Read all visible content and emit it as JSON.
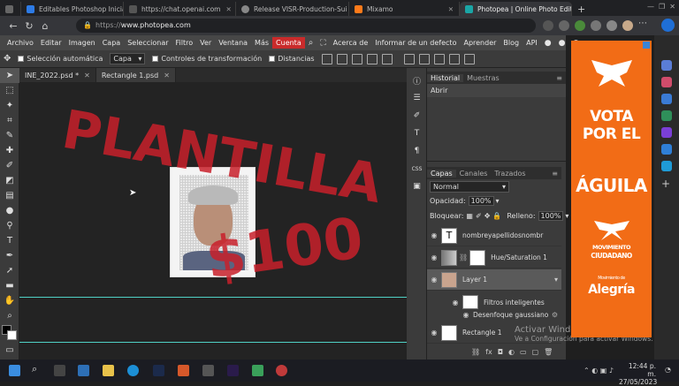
{
  "browser": {
    "tabs": [
      {
        "label": "Editables Photoshop Iniciativ",
        "color": "#2d7be6"
      },
      {
        "label": "https://chat.openai.com",
        "color": "#555555"
      },
      {
        "label": "Release VISR-Production-Sui",
        "color": "#555555"
      },
      {
        "label": "Mixamo",
        "color": "#ff7a1a"
      },
      {
        "label": "Photopea | Online Photo Edit",
        "color": "#1aa6a6"
      }
    ],
    "new_tab": "+",
    "url_scheme": "https://",
    "url_host": "www.photopea.com"
  },
  "menu": {
    "items": [
      "Archivo",
      "Editar",
      "Imagen",
      "Capa",
      "Seleccionar",
      "Filtro",
      "Ver",
      "Ventana",
      "Más"
    ],
    "account": "Cuenta",
    "right_items": [
      "Acerca de",
      "Informar de un defecto",
      "Aprender",
      "Blog",
      "API"
    ]
  },
  "options": {
    "auto_select": "Selección automática",
    "layer_select": "Capa",
    "transform_controls": "Controles de transformación",
    "distances": "Distancias"
  },
  "documents": {
    "tabs": [
      "INE_2022.psd *",
      "Rectangle 1.psd"
    ]
  },
  "canvas": {
    "watermark_line1": "PLANTILLA",
    "watermark_line2": "$100",
    "watermark_color": "#c8202a"
  },
  "history": {
    "tabs": [
      "Historial",
      "Muestras"
    ],
    "items": [
      "Abrir"
    ]
  },
  "layers_panel": {
    "tabs": [
      "Capas",
      "Canales",
      "Trazados"
    ],
    "blend_mode": "Normal",
    "opacity_label": "Opacidad:",
    "opacity_value": "100%",
    "lock_label": "Bloquear:",
    "fill_label": "Relleno:",
    "fill_value": "100%",
    "layers": [
      {
        "name": "nombreyapellidosnombr",
        "kind": "text"
      },
      {
        "name": "Hue/Saturation 1",
        "kind": "adjustment"
      },
      {
        "name": "Layer 1",
        "kind": "image"
      },
      {
        "name": "Filtros inteligentes",
        "kind": "filter-group"
      },
      {
        "name": "Desenfoque gaussiano",
        "kind": "filter"
      },
      {
        "name": "Rectangle 1",
        "kind": "shape"
      }
    ]
  },
  "ad": {
    "line1": "VOTA POR EL",
    "line2": "ÁGUILA",
    "brand1_line1": "MOVIMIENTO",
    "brand1_line2": "CIUDADANO",
    "brand2_line1": "Movimiento de",
    "brand2_line2": "Alegría",
    "bg_color": "#f26c16"
  },
  "windows_activation": {
    "title": "Activar Windows",
    "subtitle": "Ve a Configuración para activar Windows."
  },
  "taskbar": {
    "time": "12:44 p. m.",
    "date": "27/05/2023"
  }
}
